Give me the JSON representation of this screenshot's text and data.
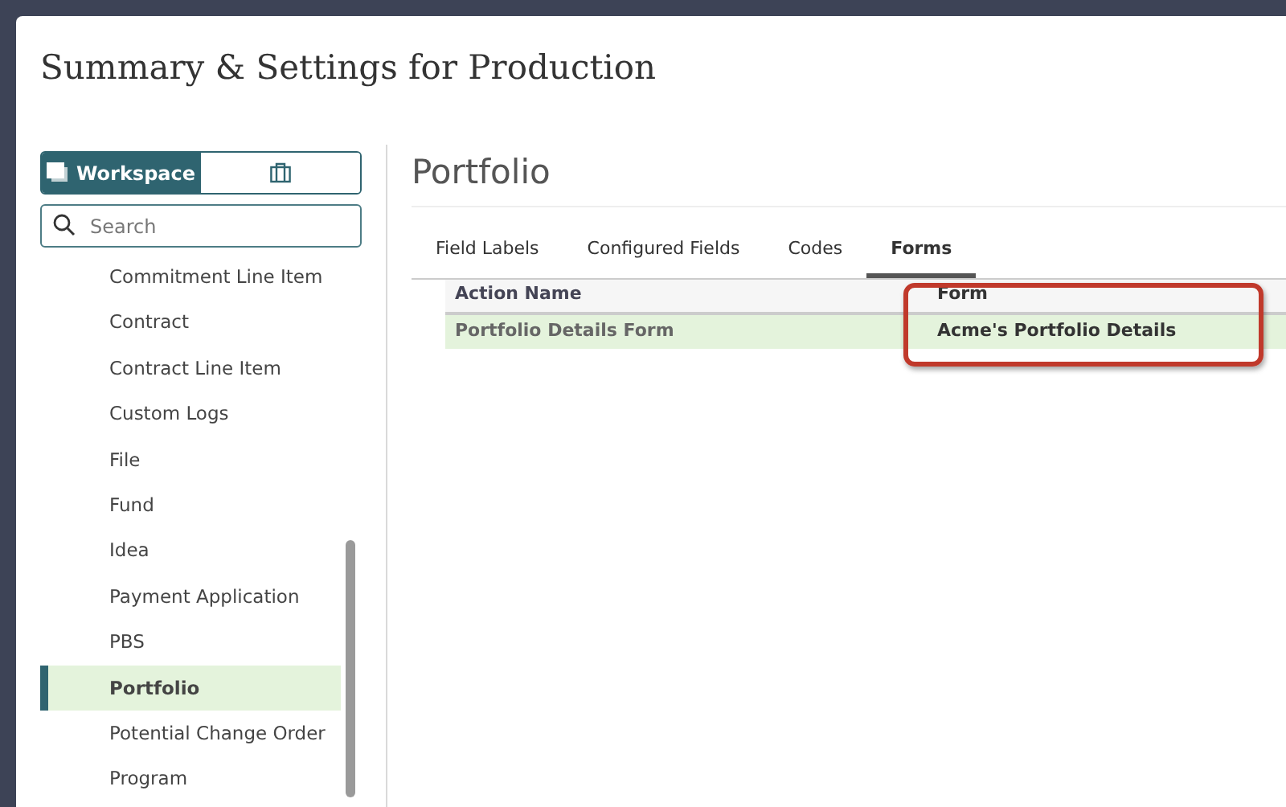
{
  "dialog": {
    "title": "Summary & Settings for Production"
  },
  "sidebar": {
    "toggle": [
      {
        "kind": "workspace",
        "label": "Workspace",
        "selected": true
      },
      {
        "kind": "briefcase",
        "selected": false
      }
    ],
    "search": {
      "placeholder": "Search"
    },
    "items": [
      {
        "label": "Commitment Line Item",
        "selected": false
      },
      {
        "label": "Contract",
        "selected": false
      },
      {
        "label": "Contract Line Item",
        "selected": false
      },
      {
        "label": "Custom Logs",
        "selected": false
      },
      {
        "label": "File",
        "selected": false
      },
      {
        "label": "Fund",
        "selected": false
      },
      {
        "label": "Idea",
        "selected": false
      },
      {
        "label": "Payment Application",
        "selected": false
      },
      {
        "label": "PBS",
        "selected": false
      },
      {
        "label": "Portfolio",
        "selected": true
      },
      {
        "label": "Potential Change Order",
        "selected": false
      },
      {
        "label": "Program",
        "selected": false
      }
    ]
  },
  "content": {
    "heading": "Portfolio",
    "tabs": [
      {
        "label": "Field Labels",
        "selected": false
      },
      {
        "label": "Configured Fields",
        "selected": false
      },
      {
        "label": "Codes",
        "selected": false
      },
      {
        "label": "Forms",
        "selected": true
      }
    ],
    "table": {
      "columns": [
        {
          "label": "Action Name",
          "highlighted": false
        },
        {
          "label": "Form",
          "highlighted": true
        }
      ],
      "rows": [
        {
          "cells": [
            "Portfolio Details Form",
            "Acme's Portfolio Details"
          ],
          "selected": true
        }
      ]
    }
  }
}
